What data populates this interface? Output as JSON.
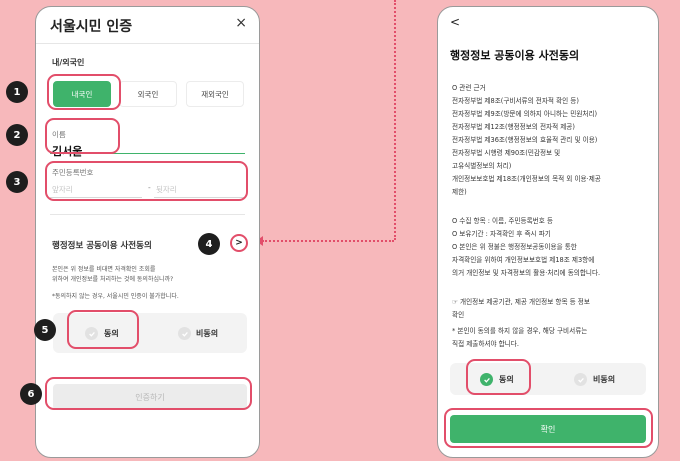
{
  "left": {
    "title": "서울시민 인증",
    "close_icon": "×",
    "nationality_label": "내/외국인",
    "nationality_options": [
      "내국인",
      "외국인",
      "재외국인"
    ],
    "name_label": "이름",
    "name_value": "김서울",
    "rrn_label": "주민등록번호",
    "rrn_front_placeholder": "앞자리",
    "rrn_dash": "-",
    "rrn_back_placeholder": "뒷자리",
    "consent_title": "행정정보 공동이용 사전동의",
    "consent_desc_1": "본인은 위 정보를 비대면 자격확인 조회를",
    "consent_desc_2": "위하여 개인정보를 처리하는 것에 동의하십니까?",
    "consent_note": "*동의하지 않는 경우, 서울시민 인증이 불가합니다.",
    "agree_label": "동의",
    "disagree_label": "비동의",
    "submit_label": "인증하기"
  },
  "right": {
    "back_icon": "<",
    "title": "행정정보 공동이용 사전동의",
    "body_lines": [
      "O 관련 근거",
      "전자정부법 제8조(구비서류의 전자적 확인 등)",
      "전자정부법 제9조(방문에 의하지 아니하는 민원처리)",
      "전자정부법 제12조(행정정보의 전자적 제공)",
      "전자정부법 제36조(행정정보의 효율적 관리 및 이용)",
      "전자정부법 시행령 제90조(민감정보 및",
      "고유식별정보의 처리)",
      "개인정보보호법 제18조(개인정보의 목적 외 이용·제공",
      "제한)",
      "",
      "O 수집 항목 : 이름, 주민등록번호 등",
      "O 보유기간 : 자격확인 후 즉시 파기",
      "O 본인은 위 정불은 행정정보공동이용을 통한",
      "자격확인을 위하여 개인정보보호법 제18조 제3항에",
      "의거 개인정보 및 자격정보의 활용·처리에 동의합니다.",
      "",
      "☞ 개인정보 제공기관, 제공 개인정보 항목 등 정보",
      "확인",
      "* 본인이 동의를 하지 않을 경우, 해당 구비서류는",
      "직접 제출하셔야 합니다."
    ],
    "agree_label": "동의",
    "disagree_label": "비동의",
    "confirm_label": "확인"
  },
  "badges": [
    "1",
    "2",
    "3",
    "4",
    "5",
    "6"
  ],
  "chevron_icon": ">",
  "colors": {
    "accent": "#3fb36b",
    "highlight": "#e24e6a",
    "background": "#f7b8bb"
  }
}
